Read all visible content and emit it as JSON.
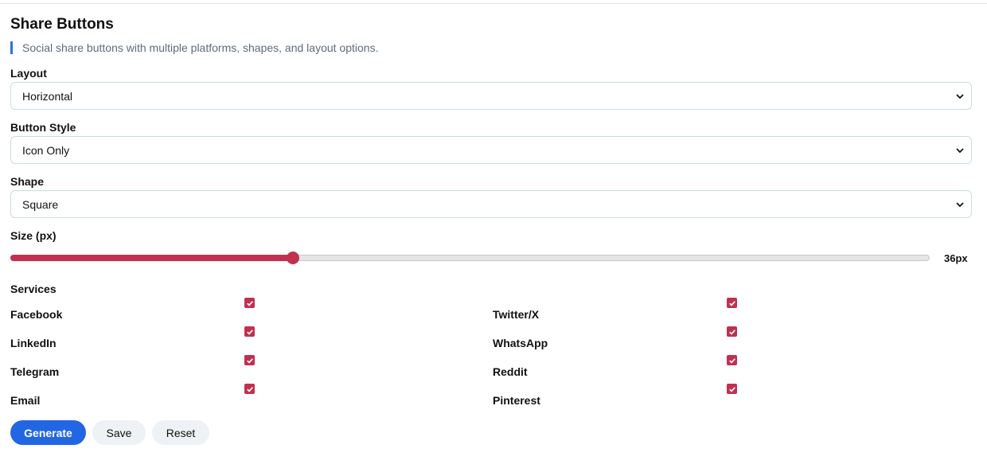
{
  "header": {
    "title": "Share Buttons",
    "description": "Social share buttons with multiple platforms, shapes, and layout options."
  },
  "form": {
    "layout": {
      "label": "Layout",
      "value": "Horizontal"
    },
    "button_style": {
      "label": "Button Style",
      "value": "Icon Only"
    },
    "shape": {
      "label": "Shape",
      "value": "Square"
    },
    "size": {
      "label": "Size (px)",
      "value_text": "36px",
      "fraction": 0.307
    }
  },
  "services": {
    "label": "Services",
    "items": [
      {
        "label": "Facebook",
        "checked": true
      },
      {
        "label": "Twitter/X",
        "checked": true
      },
      {
        "label": "LinkedIn",
        "checked": true
      },
      {
        "label": "WhatsApp",
        "checked": true
      },
      {
        "label": "Telegram",
        "checked": true
      },
      {
        "label": "Reddit",
        "checked": true
      },
      {
        "label": "Email",
        "checked": true
      },
      {
        "label": "Pinterest",
        "checked": true
      }
    ]
  },
  "actions": {
    "generate": "Generate",
    "save": "Save",
    "reset": "Reset"
  },
  "colors": {
    "accent": "#c2304f",
    "primary_button": "#2266e3",
    "description_bar": "#2f6fe0"
  }
}
